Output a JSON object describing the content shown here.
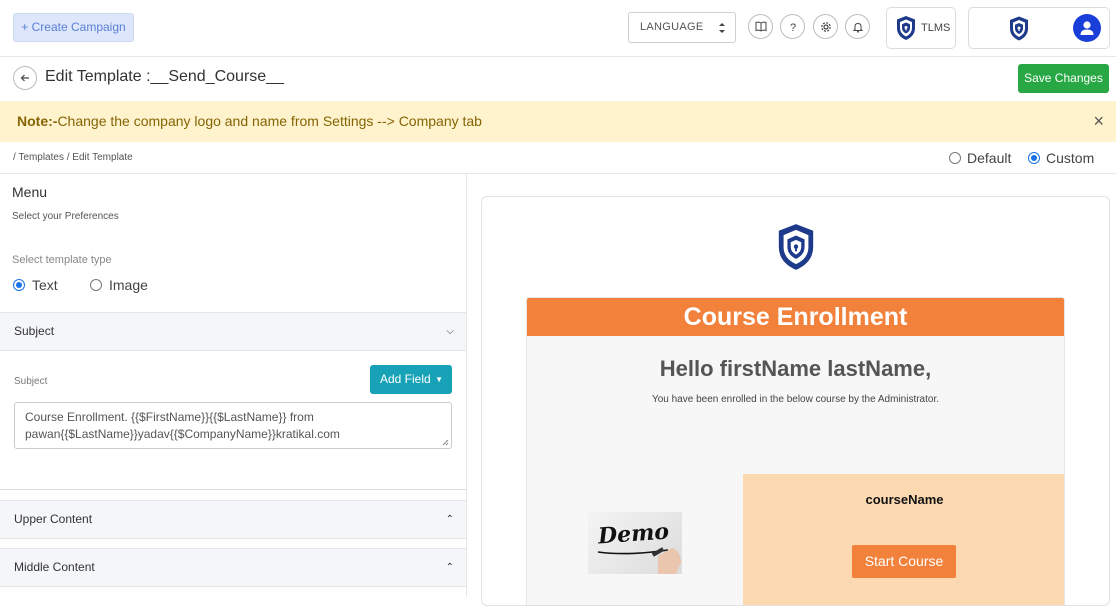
{
  "topbar": {
    "create_label": "+ Create Campaign",
    "language_value": "LANGUAGE",
    "tlms_label": "TLMS",
    "icons": [
      "book-icon",
      "help-icon",
      "settings-icon",
      "bell-icon"
    ]
  },
  "header": {
    "title": "Edit Template :__Send_Course__",
    "save_label": "Save Changes"
  },
  "note": {
    "prefix": "Note:-",
    "text": "Change the company logo and name from Settings --> Company tab",
    "close": "×"
  },
  "breadcrumb": "/ Templates / Edit Template",
  "mode": {
    "options": [
      "Default",
      "Custom"
    ],
    "selected": "Custom"
  },
  "menu": {
    "title": "Menu",
    "subtitle": "Select your Preferences",
    "type_label": "Select template type",
    "type_options": [
      "Text",
      "Image"
    ],
    "type_selected": "Text"
  },
  "sections": {
    "subject": "Subject",
    "upper": "Upper Content",
    "middle": "Middle Content"
  },
  "subject_field": {
    "label": "Subject",
    "add_field": "Add Field",
    "value": "Course Enrollment. {{$FirstName}}{{$LastName}} from pawan{{$LastName}}yadav{{$CompanyName}}kratikal.com"
  },
  "email_preview": {
    "header": "Course Enrollment",
    "greeting": "Hello firstName lastName,",
    "line": "You have been enrolled in the below course by the Administrator.",
    "course_name": "courseName",
    "start_button": "Start Course",
    "image_text": "Demo"
  },
  "colors": {
    "accent_orange": "#f2813b",
    "card_peach": "#fdd9b1",
    "save_green": "#28a745",
    "add_field_teal": "#17a2b8",
    "note_bg": "#fff3cd",
    "logo_navy": "#1e3a8a"
  }
}
